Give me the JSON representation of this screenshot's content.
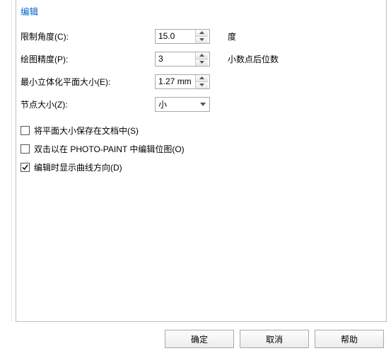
{
  "section_title": "编辑",
  "rows": {
    "constrain_angle": {
      "label": "限制角度(C):",
      "value": "15.0",
      "unit": "度"
    },
    "drawing_precision": {
      "label": "绘图精度(P):",
      "value": "3",
      "unit": "小数点后位数"
    },
    "min_extrude": {
      "label": "最小立体化平面大小(E):",
      "value": "1.27 mm",
      "unit": ""
    },
    "node_size": {
      "label": "节点大小(Z):",
      "value": "小",
      "unit": ""
    }
  },
  "checks": {
    "save_plane_size": {
      "label": "将平面大小保存在文档中(S)",
      "checked": false
    },
    "dblclick_photo_paint": {
      "label": "双击以在 PHOTO-PAINT 中编辑位图(O)",
      "checked": false
    },
    "show_curve_dir": {
      "label": "编辑时显示曲线方向(D)",
      "checked": true
    }
  },
  "buttons": {
    "ok": "确定",
    "cancel": "取消",
    "help": "帮助"
  }
}
